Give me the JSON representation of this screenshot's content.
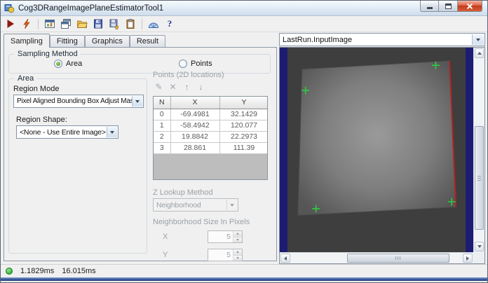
{
  "window": {
    "title": "Cog3DRangeImagePlaneEstimatorTool1"
  },
  "toolbar": {
    "icons": [
      {
        "name": "run-icon"
      },
      {
        "name": "electric-run-icon"
      },
      {
        "name": "show-image-icon"
      },
      {
        "name": "cascade-windows-icon"
      },
      {
        "name": "open-file-icon"
      },
      {
        "name": "save-icon"
      },
      {
        "name": "save-as-icon"
      },
      {
        "name": "paste-icon"
      },
      {
        "name": "measure-icon"
      },
      {
        "name": "help-icon",
        "glyph": "?"
      }
    ]
  },
  "tabs": [
    {
      "label": "Sampling",
      "active": true
    },
    {
      "label": "Fitting",
      "active": false
    },
    {
      "label": "Graphics",
      "active": false
    },
    {
      "label": "Result",
      "active": false
    }
  ],
  "sampling_method": {
    "label": "Sampling Method",
    "options": [
      {
        "label": "Area",
        "selected": true
      },
      {
        "label": "Points",
        "selected": false
      }
    ]
  },
  "area_group": {
    "label": "Area",
    "region_mode_label": "Region Mode",
    "region_mode_value": "Pixel Aligned Bounding Box Adjust Mask",
    "region_shape_label": "Region Shape:",
    "region_shape_value": "<None - Use Entire Image>"
  },
  "points_group": {
    "label": "Points (2D locations)",
    "toolbar": [
      {
        "name": "add-point-icon",
        "glyph": "✎"
      },
      {
        "name": "delete-point-icon",
        "glyph": "✕"
      },
      {
        "name": "move-up-icon",
        "glyph": "↑"
      },
      {
        "name": "move-down-icon",
        "glyph": "↓"
      }
    ],
    "table": {
      "headers": [
        "N",
        "X",
        "Y"
      ],
      "rows": [
        [
          "0",
          "-69.4981",
          "32.1429"
        ],
        [
          "1",
          "-58.4942",
          "120.077"
        ],
        [
          "2",
          "19.8842",
          "22.2973"
        ],
        [
          "3",
          "28.861",
          "111.39"
        ]
      ]
    },
    "z_lookup_label": "Z Lookup Method",
    "z_lookup_value": "Neighborhood",
    "neighborhood_size_label": "Neighborhood Size In Pixels",
    "x_label": "X",
    "x_value": "5",
    "y_label": "Y",
    "y_value": "5"
  },
  "display": {
    "image_selector_value": "LastRun.InputImage",
    "marker_color": "#2ecc40",
    "edge_line_color": "#b42222",
    "background_color": "#3e3e3e",
    "band_color": "#1c1c74"
  },
  "status_bar": {
    "time_1": "1.1829ms",
    "time_2": "16.015ms"
  }
}
